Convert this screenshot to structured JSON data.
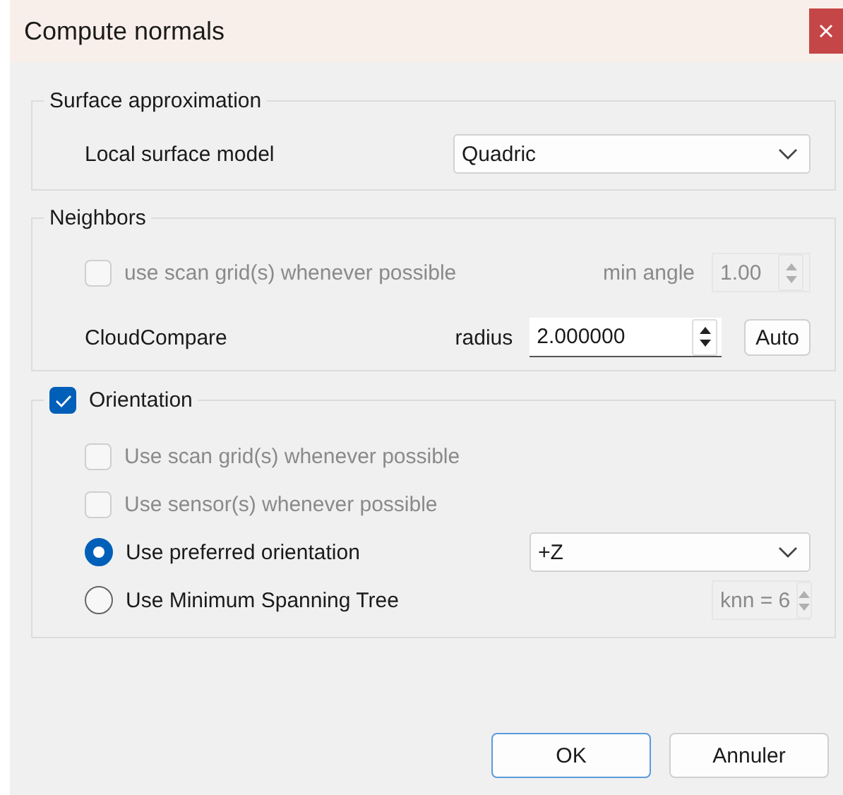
{
  "window": {
    "title": "Compute normals"
  },
  "surface_approximation": {
    "title": "Surface approximation",
    "label": "Local surface model",
    "value": "Quadric"
  },
  "neighbors": {
    "title": "Neighbors",
    "scan_grid": {
      "label": "use scan grid(s) whenever possible",
      "checked": false,
      "disabled": true
    },
    "min_angle": {
      "label": "min angle",
      "value": "1.00",
      "disabled": true
    },
    "method": "CloudCompare",
    "radius": {
      "label": "radius",
      "value": "2.000000"
    },
    "auto_button": "Auto"
  },
  "orientation": {
    "title": "Orientation",
    "checked": true,
    "options": [
      {
        "kind": "checkbox",
        "label": "Use scan grid(s) whenever possible",
        "checked": false,
        "disabled": true
      },
      {
        "kind": "checkbox",
        "label": "Use sensor(s) whenever possible",
        "checked": false,
        "disabled": true
      },
      {
        "kind": "radio",
        "label": "Use preferred orientation",
        "selected": true,
        "control": {
          "kind": "dropdown",
          "value": "+Z"
        }
      },
      {
        "kind": "radio",
        "label": "Use Minimum Spanning Tree",
        "selected": false,
        "control": {
          "kind": "spinbox",
          "value": "knn = 6",
          "disabled": true
        }
      }
    ]
  },
  "buttons": [
    {
      "label": "OK",
      "primary": true
    },
    {
      "label": "Annuler",
      "primary": false
    }
  ]
}
